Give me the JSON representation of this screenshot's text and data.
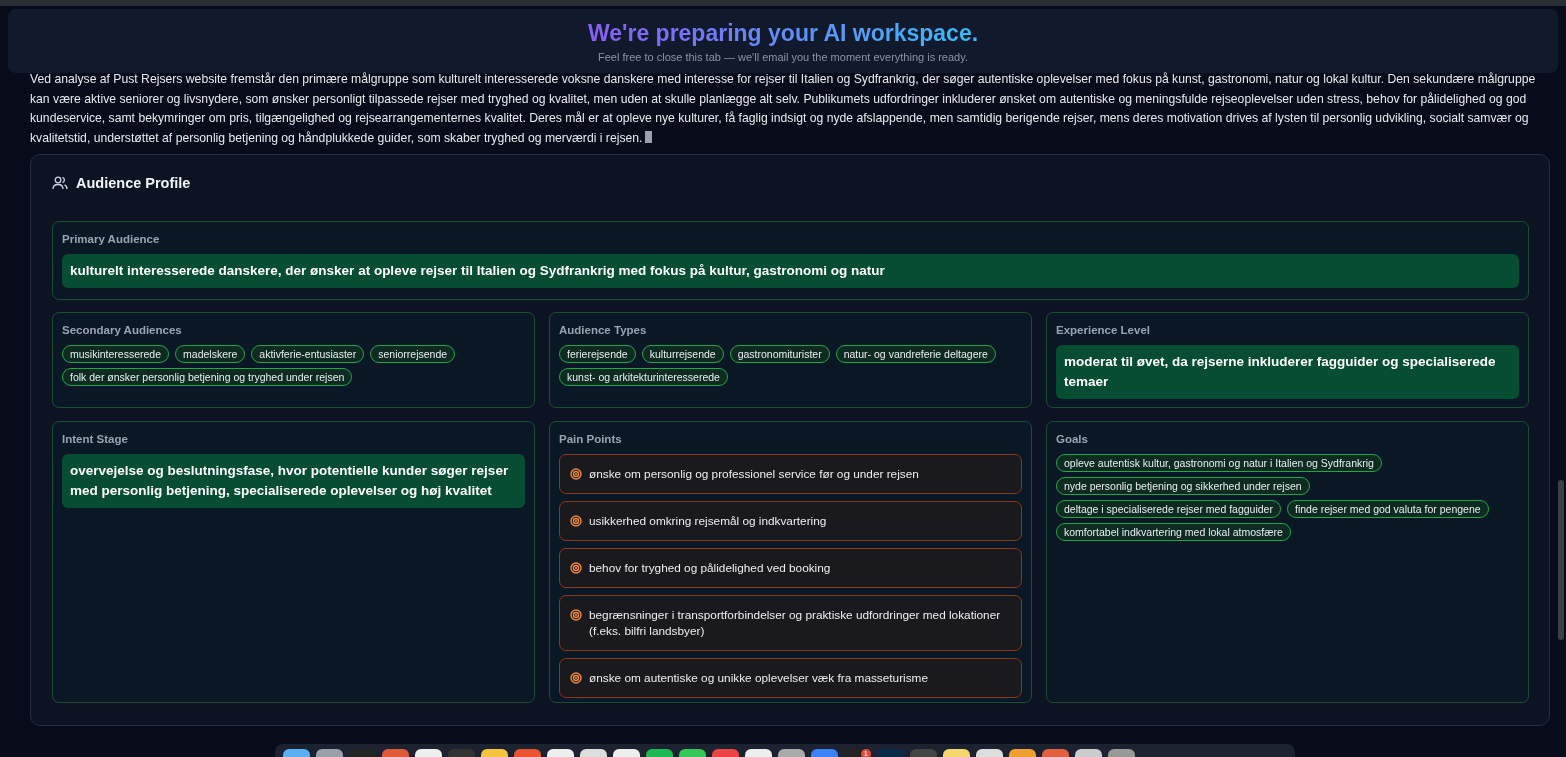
{
  "banner": {
    "title": "We're preparing your AI workspace.",
    "subtitle": "Feel free to close this tab — we'll email you the moment everything is ready."
  },
  "analysis": "Ved analyse af Pust Rejsers website fremstår den primære målgruppe som kulturelt interesserede voksne danskere med interesse for rejser til Italien og Sydfrankrig, der søger autentiske oplevelser med fokus på kunst, gastronomi, natur og lokal kultur. Den sekundære målgruppe kan være aktive seniorer og livsnydere, som ønsker personligt tilpassede rejser med tryghed og kvalitet, men uden at skulle planlægge alt selv. Publikumets udfordringer inkluderer ønsket om autentiske og meningsfulde rejseoplevelser uden stress, behov for pålidelighed og god kundeservice, samt bekymringer om pris, tilgængelighed og rejsearrangementernes kvalitet. Deres mål er at opleve nye kulturer, få faglig indsigt og nyde afslappende, men samtidig berigende rejser, mens deres motivation drives af lysten til personlig udvikling, socialt samvær og kvalitetstid, understøttet af personlig betjening og håndplukkede guider, som skaber tryghed og merværdi i rejsen.",
  "profile": {
    "title": "Audience Profile",
    "primary": {
      "label": "Primary Audience",
      "text": "kulturelt interesserede danskere, der ønsker at opleve rejser til Italien og Sydfrankrig med fokus på kultur, gastronomi og natur"
    },
    "sections": [
      {
        "kind": "tags",
        "label": "Secondary Audiences",
        "items": [
          "musikinteresserede",
          "madelskere",
          "aktivferie-entusiaster",
          "seniorrejsende",
          "folk der ønsker personlig betjening og tryghed under rejsen"
        ]
      },
      {
        "kind": "tags",
        "label": "Audience Types",
        "items": [
          "ferierejsende",
          "kulturrejsende",
          "gastronomiturister",
          "natur- og vandreferie deltagere",
          "kunst- og arkitekturinteresserede"
        ]
      },
      {
        "kind": "highlight",
        "label": "Experience Level",
        "text": "moderat til øvet, da rejserne inkluderer fagguider og specialiserede temaer"
      },
      {
        "kind": "highlight",
        "label": "Intent Stage",
        "text": "overvejelse og beslutningsfase, hvor potentielle kunder søger rejser med personlig betjening, specialiserede oplevelser og høj kvalitet"
      },
      {
        "kind": "list",
        "label": "Pain Points",
        "items": [
          "ønske om personlig og professionel service før og under rejsen",
          "usikkerhed omkring rejsemål og indkvartering",
          "behov for tryghed og pålidelighed ved booking",
          "begrænsninger i transportforbindelser og praktiske udfordringer med lokationer (f.eks. bilfri landsbyer)",
          "ønske om autentiske og unikke oplevelser væk fra masseturisme"
        ]
      },
      {
        "kind": "tags",
        "label": "Goals",
        "items": [
          "opleve autentisk kultur, gastronomi og natur i Italien og Sydfrankrig",
          "nyde personlig betjening og sikkerhed under rejsen",
          "deltage i specialiserede rejser med fagguider",
          "finde rejser med god valuta for pengene",
          "komfortabel indkvartering med lokal atmosfære"
        ]
      }
    ]
  },
  "dock": {
    "badge": "1"
  }
}
